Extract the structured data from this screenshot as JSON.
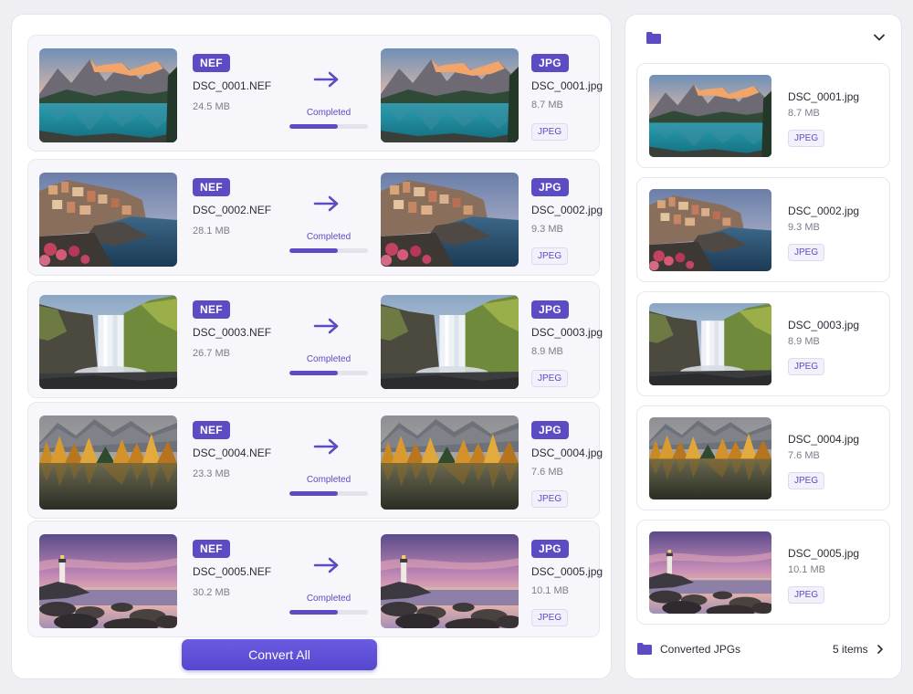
{
  "accent_color": "#5b4cc4",
  "conversions": [
    {
      "src_format": "NEF",
      "src_name": "DSC_0001.NEF",
      "src_size": "24.5 MB",
      "status": "Completed",
      "progress": 0.62,
      "dst_format": "JPG",
      "dst_name": "DSC_0001.jpg",
      "dst_size": "8.7 MB",
      "type_label": "JPEG",
      "scene": "mountain-lake"
    },
    {
      "src_format": "NEF",
      "src_name": "DSC_0002.NEF",
      "src_size": "28.1 MB",
      "status": "Completed",
      "progress": 0.62,
      "dst_format": "JPG",
      "dst_name": "DSC_0002.jpg",
      "dst_size": "9.3 MB",
      "type_label": "JPEG",
      "scene": "coastal-village"
    },
    {
      "src_format": "NEF",
      "src_name": "DSC_0003.NEF",
      "src_size": "26.7 MB",
      "status": "Completed",
      "progress": 0.62,
      "dst_format": "JPG",
      "dst_name": "DSC_0003.jpg",
      "dst_size": "8.9 MB",
      "type_label": "JPEG",
      "scene": "waterfall"
    },
    {
      "src_format": "NEF",
      "src_name": "DSC_0004.NEF",
      "src_size": "23.3 MB",
      "status": "Completed",
      "progress": 0.62,
      "dst_format": "JPG",
      "dst_name": "DSC_0004.jpg",
      "dst_size": "7.6 MB",
      "type_label": "JPEG",
      "scene": "autumn-forest"
    },
    {
      "src_format": "NEF",
      "src_name": "DSC_0005.NEF",
      "src_size": "30.2 MB",
      "status": "Completed",
      "progress": 0.62,
      "dst_format": "JPG",
      "dst_name": "DSC_0005.jpg",
      "dst_size": "10.1 MB",
      "type_label": "JPEG",
      "scene": "lighthouse"
    }
  ],
  "convert_all_label": "Convert All",
  "output": {
    "header_icon": "folder-icon",
    "header_toggle_icon": "chevron-down-icon",
    "folder_name": "Converted JPGs",
    "item_count": "5 items",
    "files": [
      {
        "name": "DSC_0001.jpg",
        "size": "8.7 MB",
        "type_label": "JPEG"
      },
      {
        "name": "DSC_0002.jpg",
        "size": "9.3 MB",
        "type_label": "JPEG"
      },
      {
        "name": "DSC_0003.jpg",
        "size": "8.9 MB",
        "type_label": "JPEG"
      },
      {
        "name": "DSC_0004.jpg",
        "size": "7.6 MB",
        "type_label": "JPEG"
      },
      {
        "name": "DSC_0005.jpg",
        "size": "10.1 MB",
        "type_label": "JPEG"
      }
    ]
  }
}
